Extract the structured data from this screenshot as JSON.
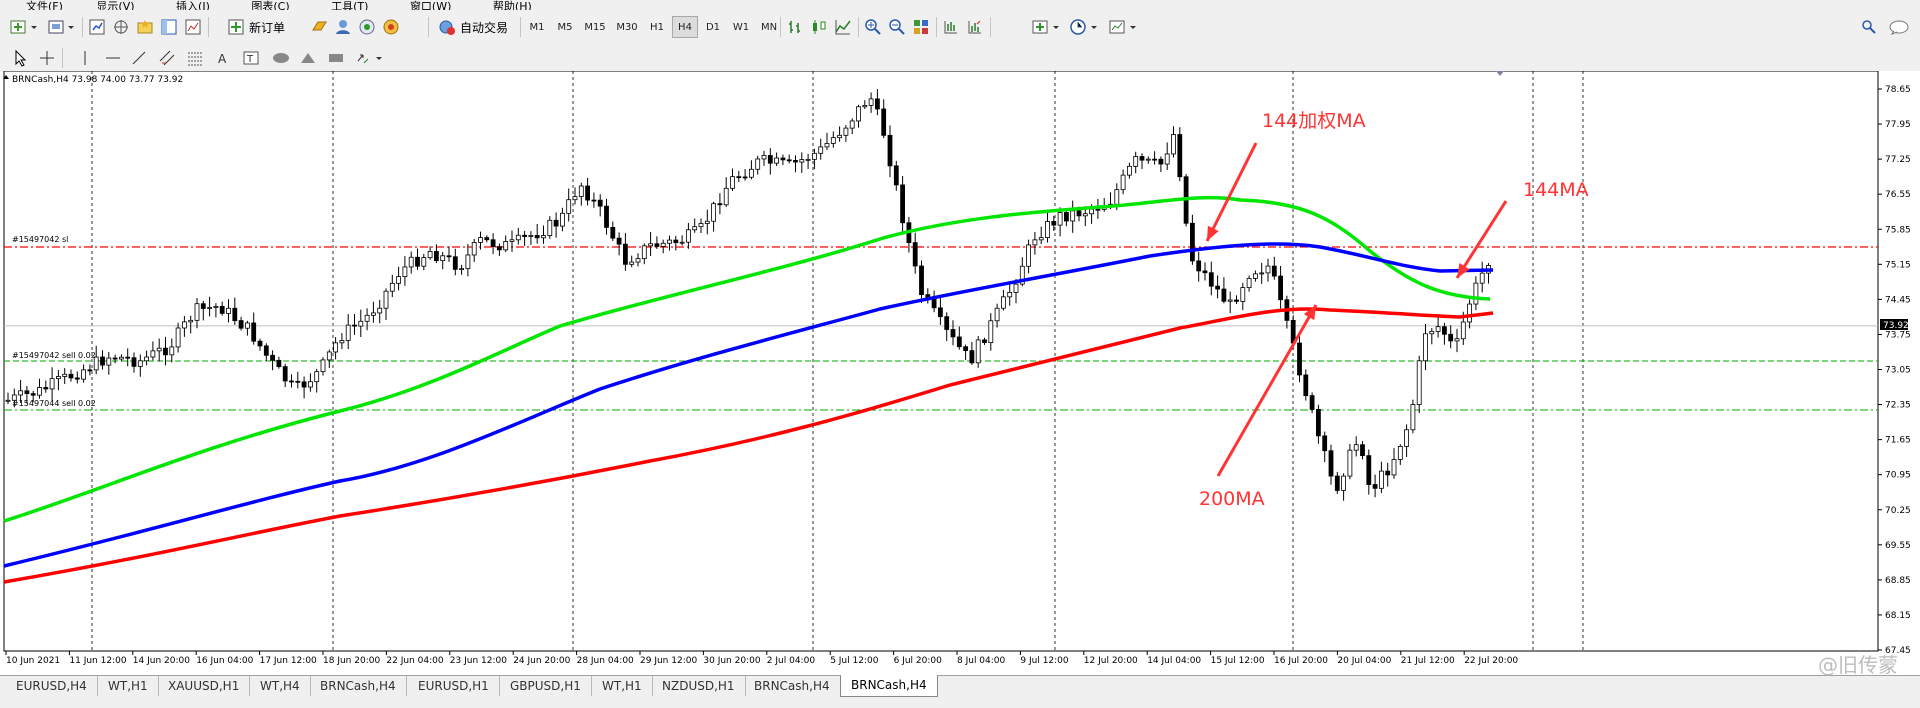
{
  "menu": [
    "文件(F)",
    "显示(V)",
    "插入(I)",
    "图表(C)",
    "工具(T)",
    "窗口(W)",
    "帮助(H)"
  ],
  "toolbar": {
    "new_order": "新订单",
    "auto_trade": "自动交易",
    "timeframes": [
      "M1",
      "M5",
      "M15",
      "M30",
      "H1",
      "H4",
      "D1",
      "W1",
      "MN"
    ],
    "active_timeframe": "H4"
  },
  "chart": {
    "header": "BRNCash,H4  73.98 74.00 73.77 73.92",
    "current_price": "73.92",
    "price_labels": [
      "78.65",
      "77.95",
      "77.25",
      "76.55",
      "75.85",
      "75.15",
      "74.45",
      "73.75",
      "73.05",
      "72.35",
      "71.65",
      "70.95",
      "70.25",
      "69.55",
      "68.85",
      "68.15",
      "67.45"
    ],
    "time_labels": [
      "10 Jun 2021",
      "11 Jun 12:00",
      "14 Jun 20:00",
      "16 Jun 04:00",
      "17 Jun 12:00",
      "18 Jun 20:00",
      "22 Jun 04:00",
      "23 Jun 12:00",
      "24 Jun 20:00",
      "28 Jun 04:00",
      "29 Jun 12:00",
      "30 Jun 20:00",
      "2 Jul 04:00",
      "5 Jul 12:00",
      "6 Jul 20:00",
      "8 Jul 04:00",
      "9 Jul 12:00",
      "12 Jul 20:00",
      "14 Jul 04:00",
      "15 Jul 12:00",
      "16 Jul 20:00",
      "20 Jul 04:00",
      "21 Jul 12:00",
      "22 Jul 20:00"
    ],
    "order_labels": {
      "sl": "#15497042 sl",
      "sell": "#15497042 sell 0.02",
      "sell2": "#15497044 sell 0.02"
    },
    "annotations": {
      "wma144": "144加权MA",
      "ma144": "144MA",
      "ma200": "200MA"
    },
    "colors": {
      "wma144": "#00e600",
      "ma144": "#0000ff",
      "ma200": "#ff0000",
      "annotation": "#ff3333"
    }
  },
  "tabs": [
    "EURUSD,H4",
    "WT,H1",
    "XAUUSD,H1",
    "WT,H4",
    "BRNCash,H4",
    "EURUSD,H1",
    "GBPUSD,H1",
    "WT,H1",
    "NZDUSD,H1",
    "BRNCash,H4",
    "BRNCash,H4"
  ],
  "active_tab_index": 10,
  "watermark": "@旧传蒙"
}
